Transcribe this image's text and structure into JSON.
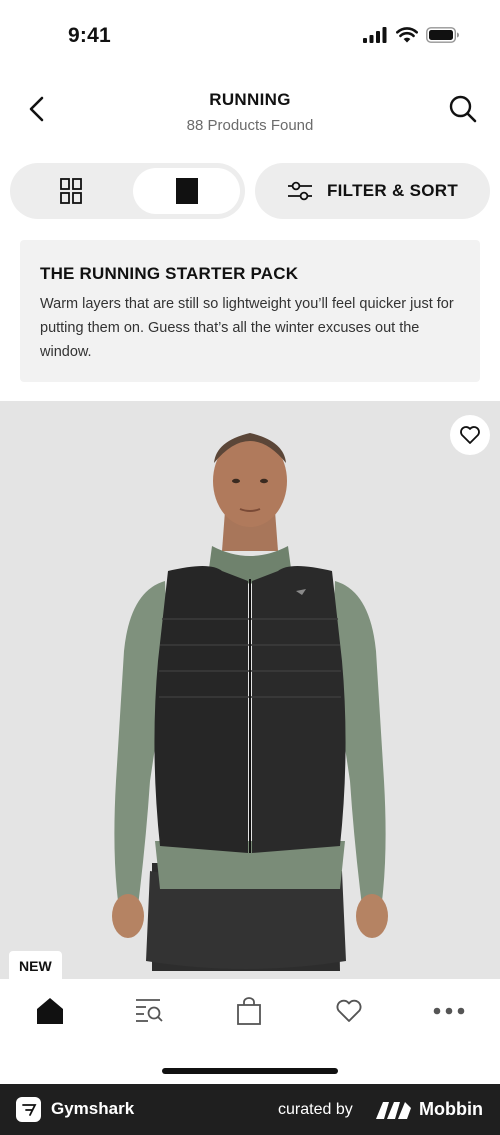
{
  "status_bar": {
    "time": "9:41"
  },
  "header": {
    "title": "RUNNING",
    "subtitle": "88 Products Found"
  },
  "toolbar": {
    "filter_label": "FILTER & SORT",
    "view_mode": "single"
  },
  "promo": {
    "title": "THE RUNNING STARTER PACK",
    "body": "Warm layers that are still so lightweight you’ll feel quicker just for putting them on. Guess that’s all the winter excuses out the window."
  },
  "product": {
    "badge": "NEW",
    "wishlisted": false
  },
  "tab_bar": {
    "items": [
      {
        "icon": "home-icon",
        "active": true
      },
      {
        "icon": "search-list-icon",
        "active": false
      },
      {
        "icon": "bag-icon",
        "active": false
      },
      {
        "icon": "heart-icon",
        "active": false
      },
      {
        "icon": "more-icon",
        "active": false
      }
    ]
  },
  "footer": {
    "app_name": "Gymshark",
    "curated_by": "curated by",
    "brand": "Mobbin"
  },
  "colors": {
    "text": "#111111",
    "muted": "#6b6b6b",
    "control_bg": "#ededed",
    "promo_bg": "#f2f2f2",
    "image_bg": "#e4e4e4",
    "footer_bg": "#1f1f1f"
  }
}
